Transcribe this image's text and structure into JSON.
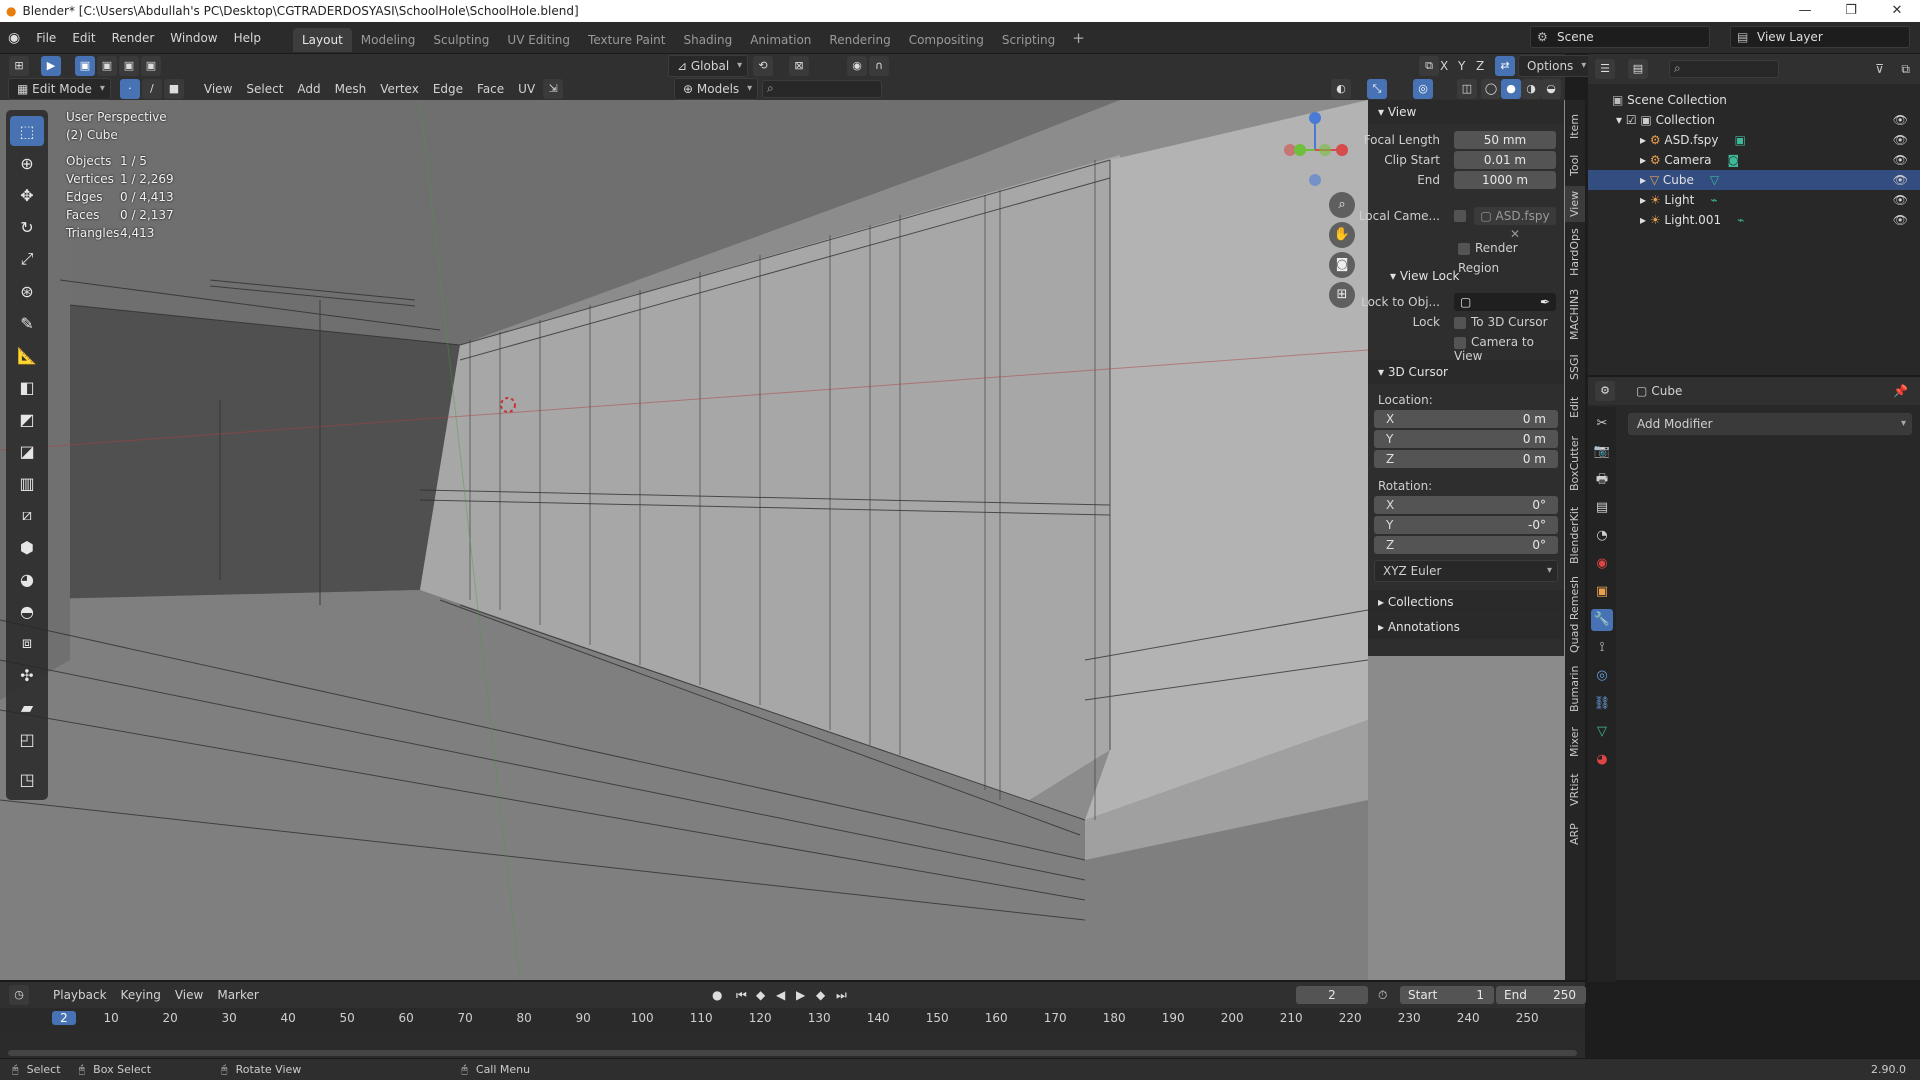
{
  "window": {
    "title": "Blender* [C:\\Users\\Abdullah's PC\\Desktop\\CGTRADERDOSYASI\\SchoolHole\\SchoolHole.blend]"
  },
  "menu": [
    "File",
    "Edit",
    "Render",
    "Window",
    "Help"
  ],
  "workspaces": [
    "Layout",
    "Modeling",
    "Sculpting",
    "UV Editing",
    "Texture Paint",
    "Shading",
    "Animation",
    "Rendering",
    "Compositing",
    "Scripting"
  ],
  "scene": {
    "label": "Scene",
    "view_layer": "View Layer"
  },
  "viewport_header": {
    "mode": "Edit Mode",
    "menus": [
      "View",
      "Select",
      "Add",
      "Mesh",
      "Vertex",
      "Edge",
      "Face",
      "UV"
    ],
    "orientation": "Global",
    "collection": "Models",
    "options": "Options",
    "axes": [
      "X",
      "Y",
      "Z"
    ]
  },
  "viewport": {
    "perspective": "User Perspective",
    "object": "(2) Cube",
    "stats": [
      {
        "k": "Objects",
        "v": "1 / 5"
      },
      {
        "k": "Vertices",
        "v": "1 / 2,269"
      },
      {
        "k": "Edges",
        "v": "0 / 4,413"
      },
      {
        "k": "Faces",
        "v": "0 / 2,137"
      },
      {
        "k": "Triangles",
        "v": "4,413"
      }
    ]
  },
  "npanel": {
    "view": {
      "title": "View",
      "focal_length_label": "Focal Length",
      "focal_length": "50 mm",
      "clip_start_label": "Clip Start",
      "clip_start": "0.01 m",
      "end_label": "End",
      "end": "1000 m",
      "local_camera_label": "Local Came...",
      "local_camera": "ASD.fspy",
      "render_region": "Render Region"
    },
    "view_lock": {
      "title": "View Lock",
      "lock_to_obj": "Lock to Obj...",
      "lock_label": "Lock",
      "to_3d_cursor": "To 3D Cursor",
      "camera_to_view": "Camera to View"
    },
    "cursor": {
      "title": "3D Cursor",
      "location_label": "Location:",
      "location": [
        {
          "a": "X",
          "v": "0 m"
        },
        {
          "a": "Y",
          "v": "0 m"
        },
        {
          "a": "Z",
          "v": "0 m"
        }
      ],
      "rotation_label": "Rotation:",
      "rotation": [
        {
          "a": "X",
          "v": "0°"
        },
        {
          "a": "Y",
          "v": "-0°"
        },
        {
          "a": "Z",
          "v": "0°"
        }
      ],
      "rotation_mode": "XYZ Euler"
    },
    "collections": "Collections",
    "annotations": "Annotations"
  },
  "side_tabs": [
    "Item",
    "Tool",
    "View",
    "HardOps",
    "MACHIN3",
    "SSGI",
    "Edit",
    "BoxCutter",
    "BlenderKit",
    "Quad Remesh",
    "Bumarin",
    "Mixer",
    "VRtist",
    "ARP"
  ],
  "outliner": {
    "root": "Scene Collection",
    "collection": "Collection",
    "items": [
      "ASD.fspy",
      "Camera",
      "Cube",
      "Light",
      "Light.001"
    ]
  },
  "properties": {
    "object": "Cube",
    "add_modifier": "Add Modifier"
  },
  "timeline": {
    "menus": [
      "Playback",
      "Keying",
      "View",
      "Marker"
    ],
    "current_frame": "2",
    "start_label": "Start",
    "start": "1",
    "end_label": "End",
    "end": "250",
    "ticks": [
      "2",
      "10",
      "20",
      "30",
      "40",
      "50",
      "60",
      "70",
      "80",
      "90",
      "100",
      "110",
      "120",
      "130",
      "140",
      "150",
      "160",
      "170",
      "180",
      "190",
      "200",
      "210",
      "220",
      "230",
      "240",
      "250"
    ]
  },
  "statusbar": {
    "select": "Select",
    "box_select": "Box Select",
    "rotate_view": "Rotate View",
    "call_menu": "Call Menu",
    "version": "2.90.0"
  },
  "colors": {
    "accent": "#4772b3",
    "viewport_bg": "#8b8b8b",
    "header": "#303030",
    "panel": "#2e2e2e"
  }
}
